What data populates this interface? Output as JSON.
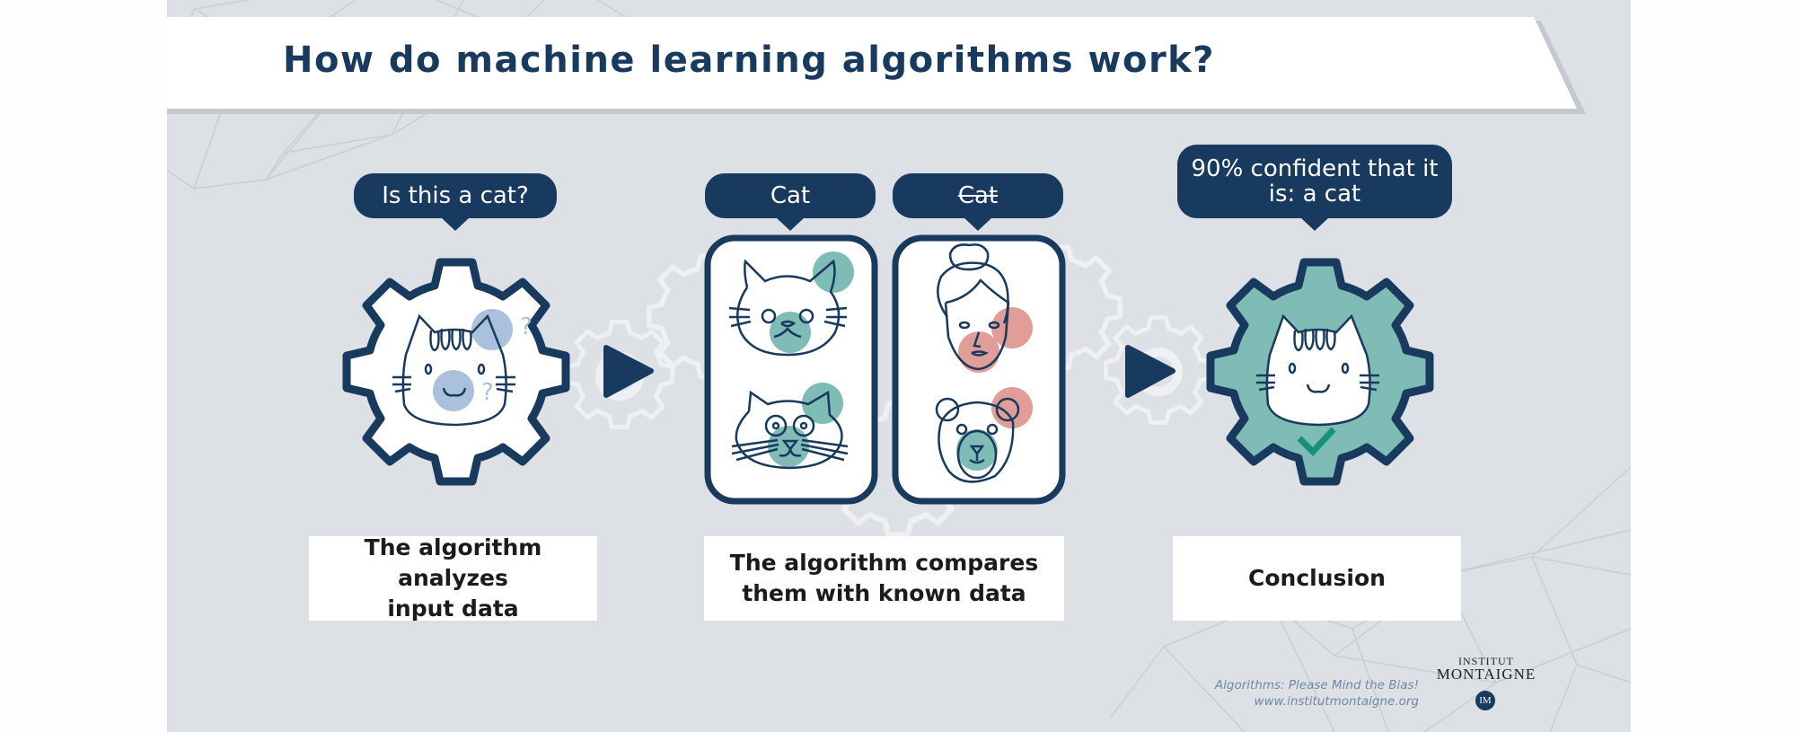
{
  "title": "How do machine learning algorithms work?",
  "steps": [
    {
      "bubble": "Is this a cat?",
      "label_line1": "The algorithm analyzes",
      "label_line2": "input data"
    },
    {
      "bubbles": [
        {
          "text": "Cat",
          "struck": false
        },
        {
          "text": "Cat",
          "struck": true
        }
      ],
      "label_line1": "The algorithm compares",
      "label_line2": "them with known data"
    },
    {
      "bubble_line1": "90% confident that it",
      "bubble_line2": "is: a cat",
      "label": "Conclusion"
    }
  ],
  "question_marks": [
    "?",
    "?"
  ],
  "footer": {
    "line1": "Algorithms: Please Mind the Bias!",
    "line2": "www.institutmontaigne.org"
  },
  "logo": {
    "top": "INSTITUT",
    "main": "MONTAIGNE",
    "badge": "IM"
  },
  "colors": {
    "navy": "#173a5e",
    "background": "#dde0e5",
    "teal": "#7fbcb5",
    "teal_highlight": "#5fb0a4",
    "blue_highlight": "#a9c1dc",
    "red_highlight": "#e19d98",
    "check_green": "#16917c"
  }
}
